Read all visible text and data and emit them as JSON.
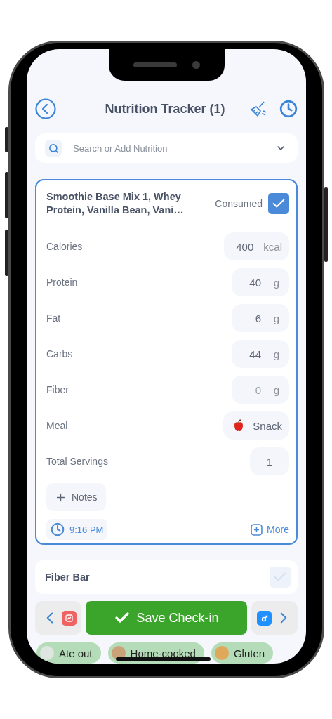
{
  "header": {
    "title": "Nutrition Tracker (1)"
  },
  "search": {
    "placeholder": "Search or Add Nutrition"
  },
  "entries": [
    {
      "name": "Smoothie Base Mix 1, Whey Protein, Vanilla Bean, Vani…",
      "consumed_label": "Consumed",
      "consumed": true,
      "selected": true,
      "fields": [
        {
          "kind": "number",
          "label": "Calories",
          "value": "400",
          "unit": "kcal"
        },
        {
          "kind": "number",
          "label": "Protein",
          "value": "40",
          "unit": "g"
        },
        {
          "kind": "number",
          "label": "Fat",
          "value": "6",
          "unit": "g"
        },
        {
          "kind": "number",
          "label": "Carbs",
          "value": "44",
          "unit": "g"
        },
        {
          "kind": "number",
          "label": "Fiber",
          "placeholder": "0",
          "unit": "g"
        },
        {
          "kind": "meal",
          "label": "Meal",
          "value": "Snack"
        },
        {
          "kind": "count",
          "label": "Total Servings",
          "value": "1"
        }
      ],
      "notes_label": "Notes",
      "time": "9:16 PM",
      "more_label": "More"
    },
    {
      "name": "Fiber Bar",
      "consumed": false,
      "selected": false
    }
  ],
  "save_button": {
    "label": "Save Check-in"
  },
  "tags": [
    {
      "label": "Ate out"
    },
    {
      "label": "Home-cooked"
    },
    {
      "label": "Gluten"
    }
  ]
}
